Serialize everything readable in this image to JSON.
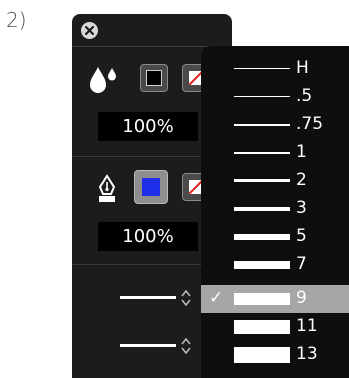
{
  "step_label": "2)",
  "panel": {
    "fill": {
      "icon": "drops-icon",
      "color_swatch": "#000000",
      "opacity": "100%"
    },
    "stroke": {
      "icon": "pen-nib-icon",
      "color_swatch": "#1f2ee8",
      "opacity": "100%"
    }
  },
  "stroke_width_menu": {
    "selected": "9",
    "items": [
      {
        "label": "H"
      },
      {
        "label": ".5"
      },
      {
        "label": ".75"
      },
      {
        "label": "1"
      },
      {
        "label": "2"
      },
      {
        "label": "3"
      },
      {
        "label": "5"
      },
      {
        "label": "7"
      },
      {
        "label": "9",
        "selected": true,
        "check": "✓"
      },
      {
        "label": "11"
      },
      {
        "label": "13"
      }
    ]
  }
}
